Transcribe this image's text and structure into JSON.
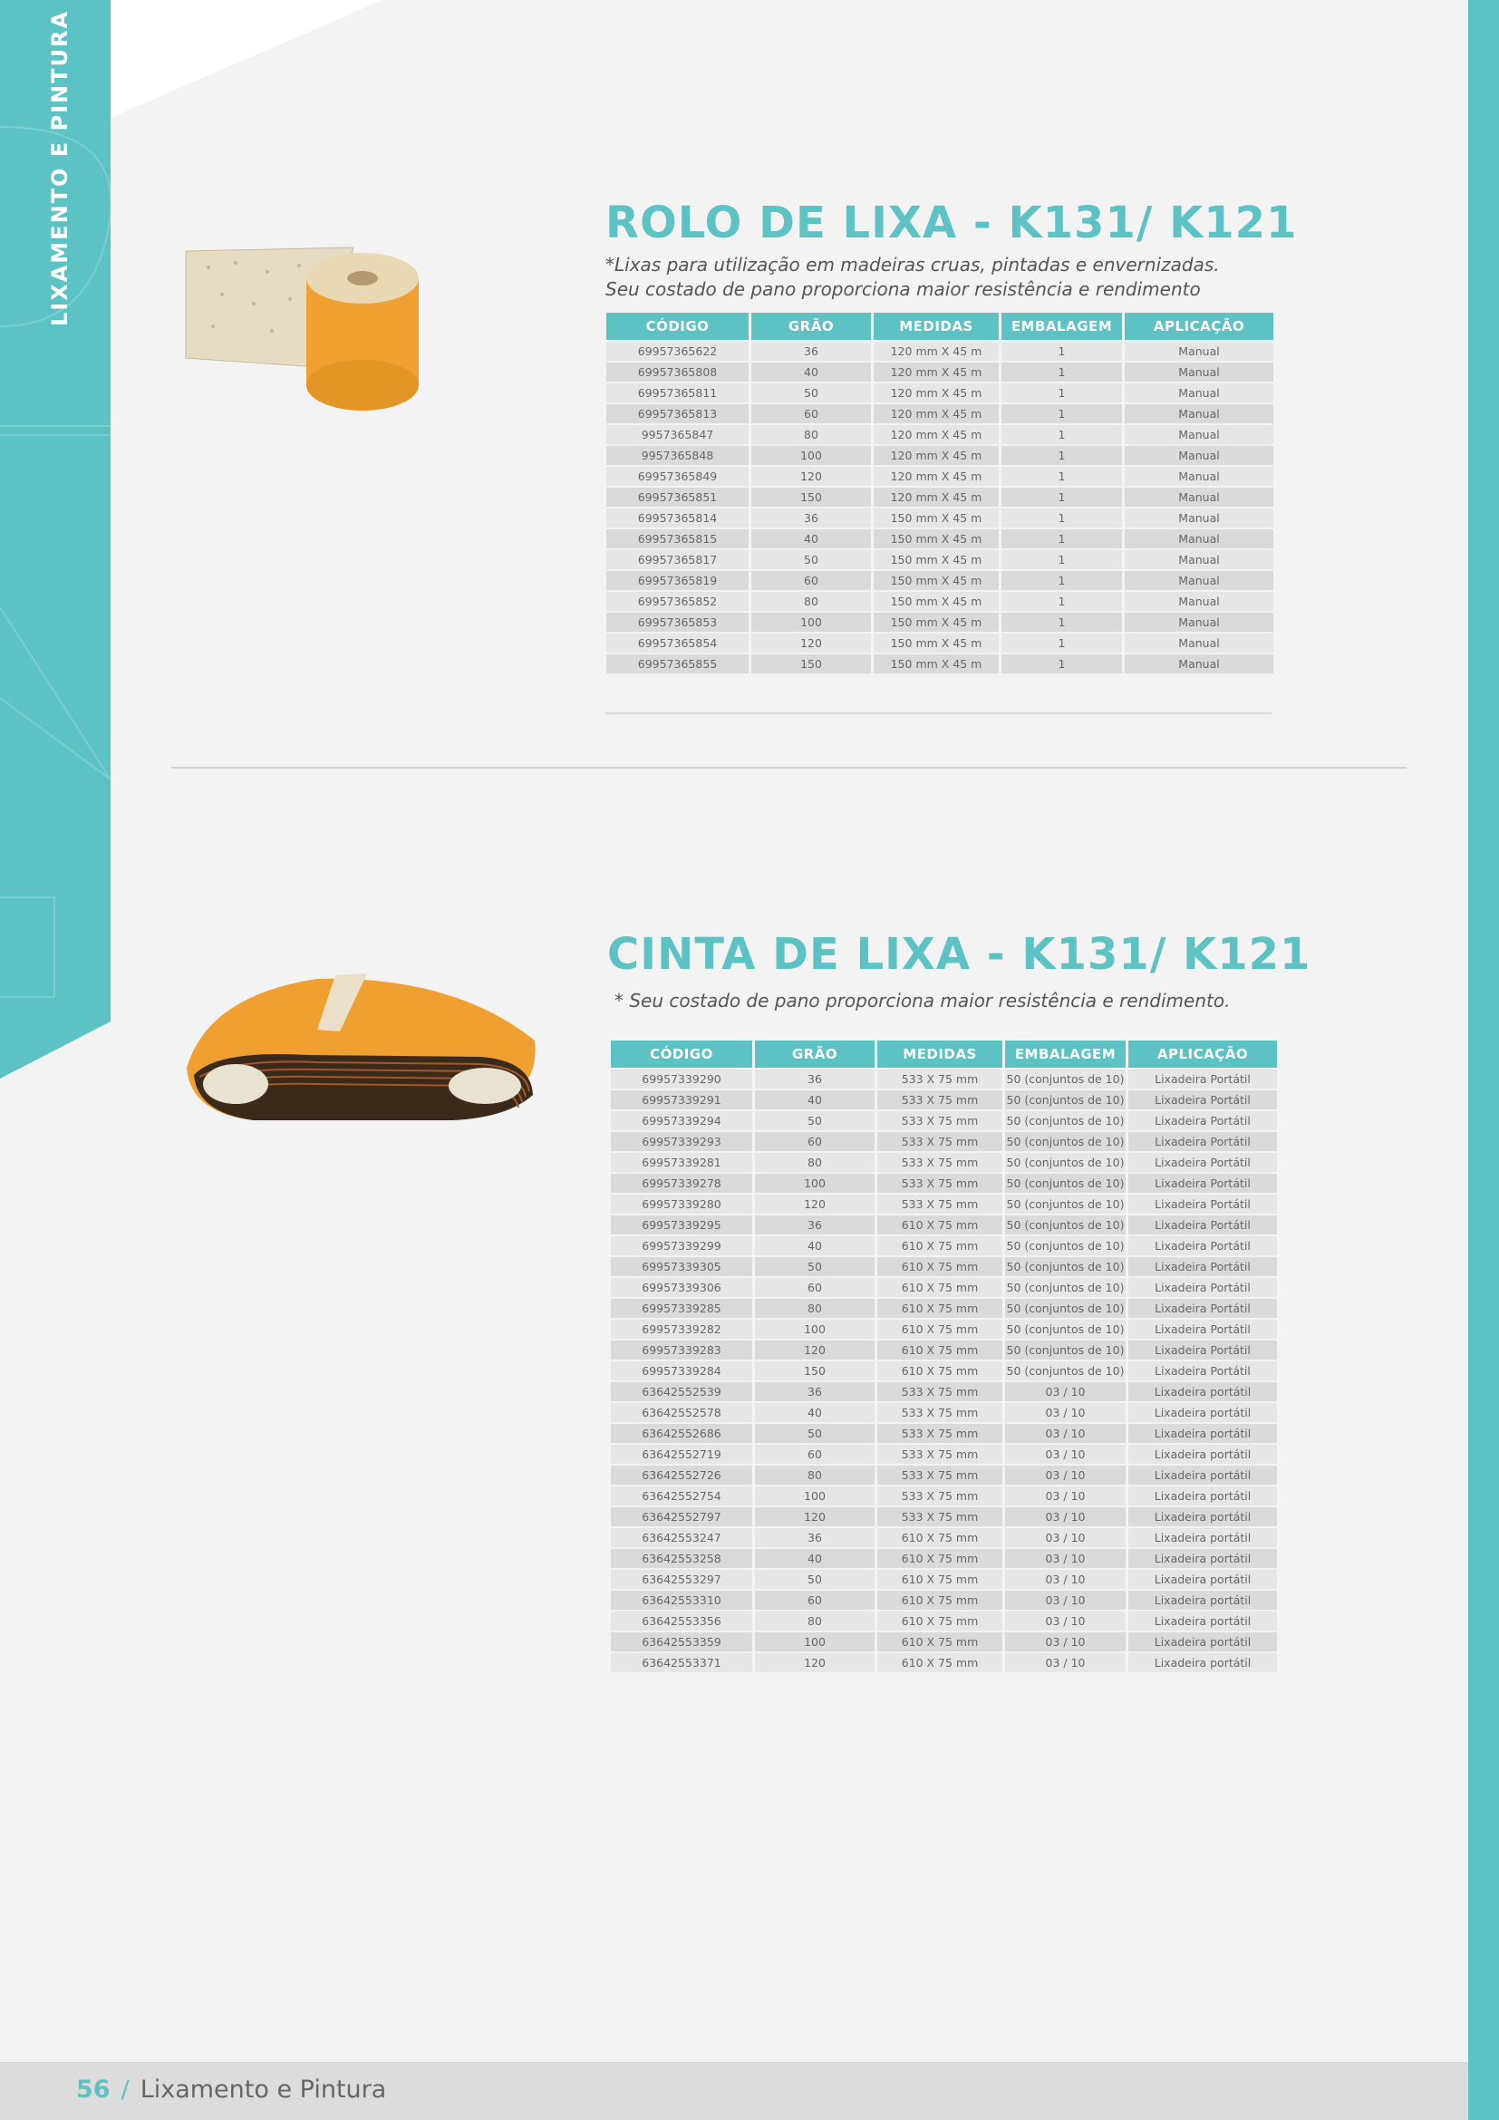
{
  "side_label": "LIXAMENTO E PINTURA",
  "footer": {
    "page_number": "56",
    "separator": "/",
    "section": "Lixamento e Pintura"
  },
  "colors": {
    "accent": "#5dc2c3",
    "background": "#f3f3f3",
    "product": "#f0a030"
  },
  "products": [
    {
      "title": "ROLO DE LIXA - K131/ K121",
      "description": "*Lixas para utilização em madeiras cruas, pintadas e envernizadas. Seu costado de pano proporciona maior resistência e rendimento",
      "image": "sandpaper-roll",
      "headers": [
        "CÓDIGO",
        "GRÃO",
        "MEDIDAS",
        "EMBALAGEM",
        "APLICAÇÃO"
      ],
      "rows": [
        [
          "69957365622",
          "36",
          "120 mm X 45 m",
          "1",
          "Manual"
        ],
        [
          "69957365808",
          "40",
          "120 mm X 45 m",
          "1",
          "Manual"
        ],
        [
          "69957365811",
          "50",
          "120 mm X 45 m",
          "1",
          "Manual"
        ],
        [
          "69957365813",
          "60",
          "120 mm X 45 m",
          "1",
          "Manual"
        ],
        [
          "9957365847",
          "80",
          "120 mm X 45 m",
          "1",
          "Manual"
        ],
        [
          "9957365848",
          "100",
          "120 mm X 45 m",
          "1",
          "Manual"
        ],
        [
          "69957365849",
          "120",
          "120 mm X 45 m",
          "1",
          "Manual"
        ],
        [
          "69957365851",
          "150",
          "120 mm X 45 m",
          "1",
          "Manual"
        ],
        [
          "69957365814",
          "36",
          "150 mm X 45 m",
          "1",
          "Manual"
        ],
        [
          "69957365815",
          "40",
          "150 mm X 45 m",
          "1",
          "Manual"
        ],
        [
          "69957365817",
          "50",
          "150 mm X 45 m",
          "1",
          "Manual"
        ],
        [
          "69957365819",
          "60",
          "150 mm X 45 m",
          "1",
          "Manual"
        ],
        [
          "69957365852",
          "80",
          "150 mm X 45 m",
          "1",
          "Manual"
        ],
        [
          "69957365853",
          "100",
          "150 mm X 45 m",
          "1",
          "Manual"
        ],
        [
          "69957365854",
          "120",
          "150 mm X 45 m",
          "1",
          "Manual"
        ],
        [
          "69957365855",
          "150",
          "150 mm X 45 m",
          "1",
          "Manual"
        ]
      ]
    },
    {
      "title": "CINTA DE LIXA - K131/ K121",
      "description": "* Seu costado de pano proporciona maior resistência e rendimento.",
      "image": "sanding-belts",
      "headers": [
        "CÓDIGO",
        "GRÃO",
        "MEDIDAS",
        "EMBALAGEM",
        "APLICAÇÃO"
      ],
      "rows": [
        [
          "69957339290",
          "36",
          "533 X 75 mm",
          "50 (conjuntos de 10)",
          "Lixadeira Portátil"
        ],
        [
          "69957339291",
          "40",
          "533 X 75 mm",
          "50 (conjuntos de 10)",
          "Lixadeira Portátil"
        ],
        [
          "69957339294",
          "50",
          "533 X 75 mm",
          "50 (conjuntos de 10)",
          "Lixadeira Portátil"
        ],
        [
          "69957339293",
          "60",
          "533 X 75 mm",
          "50 (conjuntos de 10)",
          "Lixadeira Portátil"
        ],
        [
          "69957339281",
          "80",
          "533 X 75 mm",
          "50 (conjuntos de 10)",
          "Lixadeira Portátil"
        ],
        [
          "69957339278",
          "100",
          "533 X 75 mm",
          "50 (conjuntos de 10)",
          "Lixadeira Portátil"
        ],
        [
          "69957339280",
          "120",
          "533 X 75 mm",
          "50 (conjuntos de 10)",
          "Lixadeira Portátil"
        ],
        [
          "69957339295",
          "36",
          "610 X 75 mm",
          "50 (conjuntos de 10)",
          "Lixadeira Portátil"
        ],
        [
          "69957339299",
          "40",
          "610 X 75 mm",
          "50 (conjuntos de 10)",
          "Lixadeira Portátil"
        ],
        [
          "69957339305",
          "50",
          "610 X 75 mm",
          "50 (conjuntos de 10)",
          "Lixadeira Portátil"
        ],
        [
          "69957339306",
          "60",
          "610 X 75 mm",
          "50 (conjuntos de 10)",
          "Lixadeira Portátil"
        ],
        [
          "69957339285",
          "80",
          "610 X 75 mm",
          "50 (conjuntos de 10)",
          "Lixadeira Portátil"
        ],
        [
          "69957339282",
          "100",
          "610 X 75 mm",
          "50 (conjuntos de 10)",
          "Lixadeira Portátil"
        ],
        [
          "69957339283",
          "120",
          "610 X 75 mm",
          "50 (conjuntos de 10)",
          "Lixadeira Portátil"
        ],
        [
          "69957339284",
          "150",
          "610 X 75 mm",
          "50 (conjuntos de 10)",
          "Lixadeira Portátil"
        ],
        [
          "63642552539",
          "36",
          "533 X 75 mm",
          "03 / 10",
          "Lixadeira portátil"
        ],
        [
          "63642552578",
          "40",
          "533 X 75 mm",
          "03 / 10",
          "Lixadeira portátil"
        ],
        [
          "63642552686",
          "50",
          "533 X 75 mm",
          "03 / 10",
          "Lixadeira portátil"
        ],
        [
          "63642552719",
          "60",
          "533 X 75 mm",
          "03 / 10",
          "Lixadeira portátil"
        ],
        [
          "63642552726",
          "80",
          "533 X 75 mm",
          "03 / 10",
          "Lixadeira portátil"
        ],
        [
          "63642552754",
          "100",
          "533 X 75 mm",
          "03 / 10",
          "Lixadeira portátil"
        ],
        [
          "63642552797",
          "120",
          "533 X 75 mm",
          "03 / 10",
          "Lixadeira portátil"
        ],
        [
          "63642553247",
          "36",
          "610 X 75 mm",
          "03 / 10",
          "Lixadeira portátil"
        ],
        [
          "63642553258",
          "40",
          "610 X 75 mm",
          "03 / 10",
          "Lixadeira portátil"
        ],
        [
          "63642553297",
          "50",
          "610 X 75 mm",
          "03 / 10",
          "Lixadeira portátil"
        ],
        [
          "63642553310",
          "60",
          "610 X 75 mm",
          "03 / 10",
          "Lixadeira portátil"
        ],
        [
          "63642553356",
          "80",
          "610 X 75 mm",
          "03 / 10",
          "Lixadeira portátil"
        ],
        [
          "63642553359",
          "100",
          "610 X 75 mm",
          "03 / 10",
          "Lixadeira portátil"
        ],
        [
          "63642553371",
          "120",
          "610 X 75 mm",
          "03 / 10",
          "Lixadeira portátil"
        ]
      ]
    }
  ]
}
